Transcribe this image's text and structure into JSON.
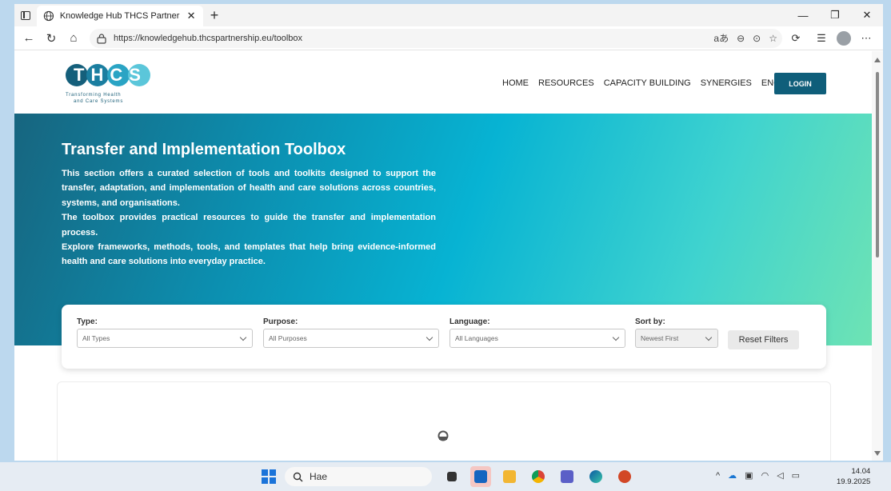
{
  "browser": {
    "tab_title": "Knowledge Hub THCS Partnership",
    "url": "https://knowledgehub.thcspartnership.eu/toolbox",
    "new_tab": "+",
    "close": "✕",
    "minimize": "—",
    "restore": "❐",
    "window_close": "✕"
  },
  "site": {
    "logo_text": "THCS",
    "logo_tagline_1": "Transforming Health",
    "logo_tagline_2": "and Care Systems",
    "nav": [
      "HOME",
      "RESOURCES",
      "CAPACITY BUILDING",
      "SYNERGIES"
    ],
    "lang": "ENG",
    "login": "LOGIN"
  },
  "hero": {
    "title": "Transfer and Implementation Toolbox",
    "p1": "This section offers a curated selection of tools and toolkits designed to support the transfer, adaptation, and implementation of health and care solutions across countries, systems, and organisations.",
    "p2": "The toolbox provides practical resources to guide the transfer and implementation process.",
    "p3": "Explore frameworks, methods, tools, and templates that help bring evidence-informed health and care solutions into everyday practice."
  },
  "filters": {
    "type_label": "Type:",
    "type_value": "All Types",
    "purpose_label": "Purpose:",
    "purpose_value": "All Purposes",
    "language_label": "Language:",
    "language_value": "All Languages",
    "sort_label": "Sort by:",
    "sort_value": "Newest First",
    "reset": "Reset Filters"
  },
  "taskbar": {
    "search_text": "Hae",
    "time": "14.04",
    "date": "19.9.2025"
  },
  "colors": {
    "brand": "#0f5e7a",
    "hero_start": "#17657f",
    "hero_end": "#6ee3b4"
  }
}
